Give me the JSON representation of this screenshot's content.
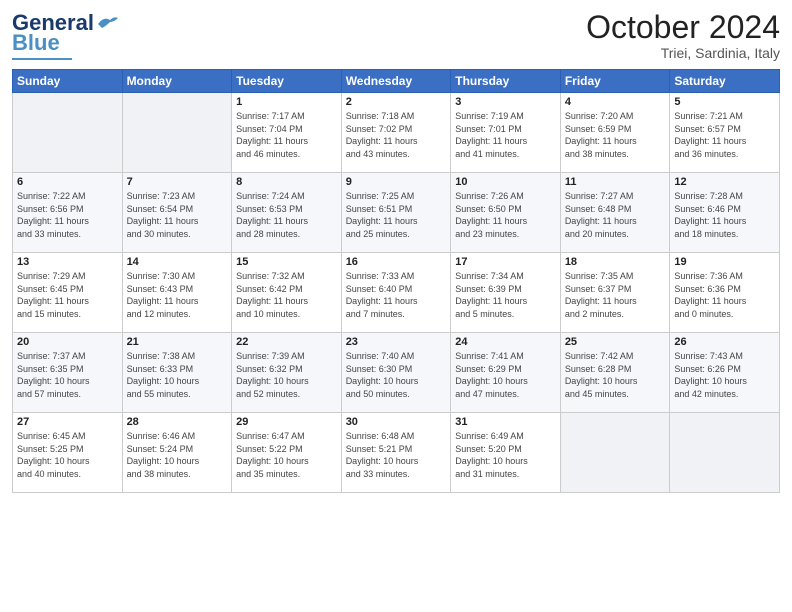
{
  "header": {
    "logo_general": "General",
    "logo_blue": "Blue",
    "month_title": "October 2024",
    "location": "Triei, Sardinia, Italy"
  },
  "weekdays": [
    "Sunday",
    "Monday",
    "Tuesday",
    "Wednesday",
    "Thursday",
    "Friday",
    "Saturday"
  ],
  "weeks": [
    [
      {
        "day": "",
        "detail": ""
      },
      {
        "day": "",
        "detail": ""
      },
      {
        "day": "1",
        "detail": "Sunrise: 7:17 AM\nSunset: 7:04 PM\nDaylight: 11 hours\nand 46 minutes."
      },
      {
        "day": "2",
        "detail": "Sunrise: 7:18 AM\nSunset: 7:02 PM\nDaylight: 11 hours\nand 43 minutes."
      },
      {
        "day": "3",
        "detail": "Sunrise: 7:19 AM\nSunset: 7:01 PM\nDaylight: 11 hours\nand 41 minutes."
      },
      {
        "day": "4",
        "detail": "Sunrise: 7:20 AM\nSunset: 6:59 PM\nDaylight: 11 hours\nand 38 minutes."
      },
      {
        "day": "5",
        "detail": "Sunrise: 7:21 AM\nSunset: 6:57 PM\nDaylight: 11 hours\nand 36 minutes."
      }
    ],
    [
      {
        "day": "6",
        "detail": "Sunrise: 7:22 AM\nSunset: 6:56 PM\nDaylight: 11 hours\nand 33 minutes."
      },
      {
        "day": "7",
        "detail": "Sunrise: 7:23 AM\nSunset: 6:54 PM\nDaylight: 11 hours\nand 30 minutes."
      },
      {
        "day": "8",
        "detail": "Sunrise: 7:24 AM\nSunset: 6:53 PM\nDaylight: 11 hours\nand 28 minutes."
      },
      {
        "day": "9",
        "detail": "Sunrise: 7:25 AM\nSunset: 6:51 PM\nDaylight: 11 hours\nand 25 minutes."
      },
      {
        "day": "10",
        "detail": "Sunrise: 7:26 AM\nSunset: 6:50 PM\nDaylight: 11 hours\nand 23 minutes."
      },
      {
        "day": "11",
        "detail": "Sunrise: 7:27 AM\nSunset: 6:48 PM\nDaylight: 11 hours\nand 20 minutes."
      },
      {
        "day": "12",
        "detail": "Sunrise: 7:28 AM\nSunset: 6:46 PM\nDaylight: 11 hours\nand 18 minutes."
      }
    ],
    [
      {
        "day": "13",
        "detail": "Sunrise: 7:29 AM\nSunset: 6:45 PM\nDaylight: 11 hours\nand 15 minutes."
      },
      {
        "day": "14",
        "detail": "Sunrise: 7:30 AM\nSunset: 6:43 PM\nDaylight: 11 hours\nand 12 minutes."
      },
      {
        "day": "15",
        "detail": "Sunrise: 7:32 AM\nSunset: 6:42 PM\nDaylight: 11 hours\nand 10 minutes."
      },
      {
        "day": "16",
        "detail": "Sunrise: 7:33 AM\nSunset: 6:40 PM\nDaylight: 11 hours\nand 7 minutes."
      },
      {
        "day": "17",
        "detail": "Sunrise: 7:34 AM\nSunset: 6:39 PM\nDaylight: 11 hours\nand 5 minutes."
      },
      {
        "day": "18",
        "detail": "Sunrise: 7:35 AM\nSunset: 6:37 PM\nDaylight: 11 hours\nand 2 minutes."
      },
      {
        "day": "19",
        "detail": "Sunrise: 7:36 AM\nSunset: 6:36 PM\nDaylight: 11 hours\nand 0 minutes."
      }
    ],
    [
      {
        "day": "20",
        "detail": "Sunrise: 7:37 AM\nSunset: 6:35 PM\nDaylight: 10 hours\nand 57 minutes."
      },
      {
        "day": "21",
        "detail": "Sunrise: 7:38 AM\nSunset: 6:33 PM\nDaylight: 10 hours\nand 55 minutes."
      },
      {
        "day": "22",
        "detail": "Sunrise: 7:39 AM\nSunset: 6:32 PM\nDaylight: 10 hours\nand 52 minutes."
      },
      {
        "day": "23",
        "detail": "Sunrise: 7:40 AM\nSunset: 6:30 PM\nDaylight: 10 hours\nand 50 minutes."
      },
      {
        "day": "24",
        "detail": "Sunrise: 7:41 AM\nSunset: 6:29 PM\nDaylight: 10 hours\nand 47 minutes."
      },
      {
        "day": "25",
        "detail": "Sunrise: 7:42 AM\nSunset: 6:28 PM\nDaylight: 10 hours\nand 45 minutes."
      },
      {
        "day": "26",
        "detail": "Sunrise: 7:43 AM\nSunset: 6:26 PM\nDaylight: 10 hours\nand 42 minutes."
      }
    ],
    [
      {
        "day": "27",
        "detail": "Sunrise: 6:45 AM\nSunset: 5:25 PM\nDaylight: 10 hours\nand 40 minutes."
      },
      {
        "day": "28",
        "detail": "Sunrise: 6:46 AM\nSunset: 5:24 PM\nDaylight: 10 hours\nand 38 minutes."
      },
      {
        "day": "29",
        "detail": "Sunrise: 6:47 AM\nSunset: 5:22 PM\nDaylight: 10 hours\nand 35 minutes."
      },
      {
        "day": "30",
        "detail": "Sunrise: 6:48 AM\nSunset: 5:21 PM\nDaylight: 10 hours\nand 33 minutes."
      },
      {
        "day": "31",
        "detail": "Sunrise: 6:49 AM\nSunset: 5:20 PM\nDaylight: 10 hours\nand 31 minutes."
      },
      {
        "day": "",
        "detail": ""
      },
      {
        "day": "",
        "detail": ""
      }
    ]
  ]
}
